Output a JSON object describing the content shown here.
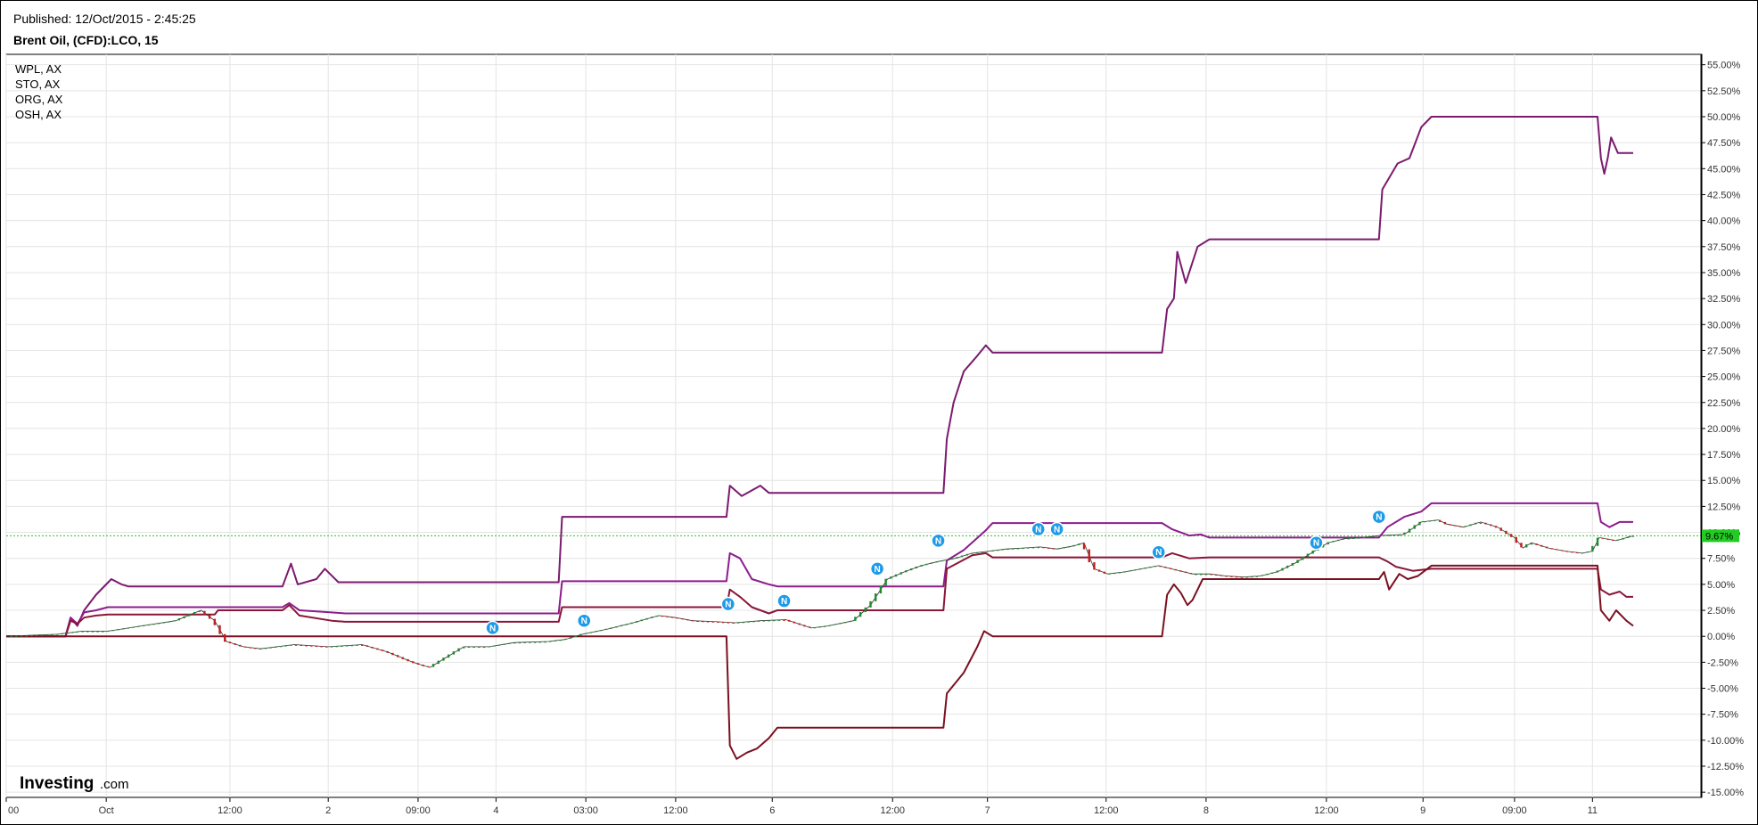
{
  "header": {
    "published": "Published: 12/Oct/2015 - 2:45:25",
    "title": "Brent Oil, (CFD):LCO, 15"
  },
  "logo": {
    "text": "Investing",
    "suffix": ".com"
  },
  "colors": {
    "wpl": "#7b1a6e",
    "sto": "#8c1c8c",
    "org": "#8a1638",
    "osh": "#7a1020",
    "up_candle": "#1e8a2e",
    "down_candle": "#c0201c",
    "price_line": "#22cc22",
    "price_label_bg": "#22cc22",
    "news_marker": "#1e9be8",
    "grid": "#e4e4e4"
  },
  "chart_data": {
    "type": "line",
    "title": "Brent Oil, (CFD):LCO, 15",
    "y_axis": {
      "position": "right",
      "range": [
        -15.5,
        56
      ],
      "ticks": [
        55,
        52.5,
        50,
        47.5,
        45,
        42.5,
        40,
        37.5,
        35,
        32.5,
        30,
        27.5,
        25,
        22.5,
        20,
        17.5,
        15,
        12.5,
        10,
        7.5,
        5,
        2.5,
        0,
        -2.5,
        -5,
        -7.5,
        -10,
        -12.5,
        -15
      ],
      "tick_labels": [
        "55.00%",
        "52.50%",
        "50.00%",
        "47.50%",
        "45.00%",
        "42.50%",
        "40.00%",
        "37.50%",
        "35.00%",
        "32.50%",
        "30.00%",
        "27.50%",
        "25.00%",
        "22.50%",
        "20.00%",
        "17.50%",
        "15.00%",
        "12.50%",
        "10.00%",
        "7.50%",
        "5.00%",
        "2.50%",
        "0.00%",
        "-2.50%",
        "-5.00%",
        "-7.50%",
        "-10.00%",
        "-12.50%",
        "-15.00%"
      ]
    },
    "x_axis": {
      "range": [
        0,
        100
      ],
      "tick_positions": [
        0,
        5.9,
        13.2,
        19.0,
        24.3,
        28.9,
        34.2,
        39.5,
        45.2,
        52.3,
        57.9,
        64.9,
        70.8,
        77.9,
        83.6,
        89.0,
        93.6
      ],
      "tick_labels": [
        "00",
        "Oct",
        "12:00",
        "2",
        "09:00",
        "4",
        "03:00",
        "12:00",
        "6",
        "12:00",
        "7",
        "12:00",
        "8",
        "12:00",
        "9",
        "09:00",
        "11"
      ]
    },
    "legend": [
      "WPL, AX",
      "STO, AX",
      "ORG, AX",
      "OSH, AX"
    ],
    "legend_placement": "top-left",
    "grid": true,
    "current_value": 9.67,
    "current_value_label": "9.67%",
    "series": [
      {
        "name": "WPL, AX",
        "points": [
          [
            0,
            0
          ],
          [
            3.5,
            0
          ],
          [
            3.8,
            1.8
          ],
          [
            4.2,
            1
          ],
          [
            4.6,
            2.5
          ],
          [
            5.3,
            4
          ],
          [
            6.2,
            5.5
          ],
          [
            6.8,
            5
          ],
          [
            7.2,
            4.8
          ],
          [
            16.3,
            4.8
          ],
          [
            16.8,
            7
          ],
          [
            17.2,
            5
          ],
          [
            18.3,
            5.5
          ],
          [
            18.8,
            6.5
          ],
          [
            19.6,
            5.2
          ],
          [
            32.6,
            5.2
          ],
          [
            32.8,
            11.5
          ],
          [
            42.5,
            11.5
          ],
          [
            42.7,
            14.5
          ],
          [
            43.4,
            13.5
          ],
          [
            44.5,
            14.5
          ],
          [
            45,
            13.8
          ],
          [
            55.3,
            13.8
          ],
          [
            55.5,
            19
          ],
          [
            55.9,
            22.5
          ],
          [
            56.5,
            25.5
          ],
          [
            57.3,
            27
          ],
          [
            57.8,
            28
          ],
          [
            58.2,
            27.3
          ],
          [
            68.2,
            27.3
          ],
          [
            68.5,
            31.5
          ],
          [
            68.9,
            32.5
          ],
          [
            69.1,
            37
          ],
          [
            69.6,
            34
          ],
          [
            70.3,
            37.5
          ],
          [
            71,
            38.2
          ],
          [
            81,
            38.2
          ],
          [
            81.2,
            43
          ],
          [
            82.1,
            45.5
          ],
          [
            82.8,
            46
          ],
          [
            83.5,
            49
          ],
          [
            84.1,
            50
          ],
          [
            93.9,
            50
          ],
          [
            94.1,
            46
          ],
          [
            94.3,
            44.5
          ],
          [
            94.5,
            46
          ],
          [
            94.7,
            48
          ],
          [
            95.1,
            46.5
          ],
          [
            96,
            46.5
          ]
        ]
      },
      {
        "name": "STO, AX",
        "points": [
          [
            0,
            0
          ],
          [
            3.5,
            0
          ],
          [
            3.8,
            1.8
          ],
          [
            4.2,
            1.2
          ],
          [
            4.6,
            2.3
          ],
          [
            5.3,
            2.5
          ],
          [
            6,
            2.8
          ],
          [
            16.3,
            2.8
          ],
          [
            16.7,
            3.2
          ],
          [
            17.3,
            2.5
          ],
          [
            19.2,
            2.3
          ],
          [
            20,
            2.2
          ],
          [
            32.6,
            2.2
          ],
          [
            32.8,
            5.3
          ],
          [
            42.5,
            5.3
          ],
          [
            42.7,
            8
          ],
          [
            43.3,
            7.5
          ],
          [
            44,
            5.5
          ],
          [
            45,
            5
          ],
          [
            45.5,
            4.8
          ],
          [
            55.3,
            4.8
          ],
          [
            55.5,
            7.3
          ],
          [
            56.5,
            8.3
          ],
          [
            57.8,
            10.2
          ],
          [
            58.2,
            10.9
          ],
          [
            68.2,
            10.9
          ],
          [
            68.8,
            10.3
          ],
          [
            69.8,
            9.7
          ],
          [
            70.5,
            9.8
          ],
          [
            71,
            9.5
          ],
          [
            81,
            9.5
          ],
          [
            81.5,
            10.5
          ],
          [
            82.5,
            11.5
          ],
          [
            83.5,
            12
          ],
          [
            84.1,
            12.8
          ],
          [
            93.9,
            12.8
          ],
          [
            94.1,
            11
          ],
          [
            94.6,
            10.5
          ],
          [
            95.2,
            11
          ],
          [
            96,
            11
          ]
        ]
      },
      {
        "name": "ORG, AX",
        "points": [
          [
            0,
            0
          ],
          [
            3.5,
            0
          ],
          [
            3.8,
            1.5
          ],
          [
            4.2,
            1.2
          ],
          [
            4.6,
            1.8
          ],
          [
            5.3,
            2
          ],
          [
            6,
            2.1
          ],
          [
            12.3,
            2.1
          ],
          [
            12.5,
            2.5
          ],
          [
            16.3,
            2.5
          ],
          [
            16.7,
            3
          ],
          [
            17.3,
            2
          ],
          [
            19.2,
            1.5
          ],
          [
            20,
            1.4
          ],
          [
            32.6,
            1.4
          ],
          [
            32.8,
            2.8
          ],
          [
            39.5,
            2.8
          ],
          [
            42.5,
            2.8
          ],
          [
            42.7,
            4.5
          ],
          [
            43.3,
            3.8
          ],
          [
            44,
            2.8
          ],
          [
            45,
            2.2
          ],
          [
            45.5,
            2.5
          ],
          [
            55.3,
            2.5
          ],
          [
            55.5,
            6.5
          ],
          [
            57,
            7.8
          ],
          [
            57.8,
            8
          ],
          [
            58.2,
            7.6
          ],
          [
            68.2,
            7.6
          ],
          [
            68.8,
            8
          ],
          [
            69.8,
            7.5
          ],
          [
            71,
            7.6
          ],
          [
            81,
            7.6
          ],
          [
            81.5,
            7.2
          ],
          [
            82,
            6.7
          ],
          [
            83,
            6.3
          ],
          [
            84.1,
            6.5
          ],
          [
            93.9,
            6.5
          ],
          [
            94.1,
            4.5
          ],
          [
            94.6,
            4
          ],
          [
            95.2,
            4.3
          ],
          [
            95.6,
            3.8
          ],
          [
            96,
            3.8
          ]
        ]
      },
      {
        "name": "OSH, AX",
        "points": [
          [
            0,
            0
          ],
          [
            42.5,
            0
          ],
          [
            42.7,
            -10.5
          ],
          [
            43.1,
            -11.8
          ],
          [
            43.7,
            -11.2
          ],
          [
            44.3,
            -10.8
          ],
          [
            45,
            -9.8
          ],
          [
            45.5,
            -8.8
          ],
          [
            55.3,
            -8.8
          ],
          [
            55.5,
            -5.5
          ],
          [
            56.5,
            -3.5
          ],
          [
            57.3,
            -1
          ],
          [
            57.7,
            0.5
          ],
          [
            58.2,
            0
          ],
          [
            68.2,
            0
          ],
          [
            68.5,
            4
          ],
          [
            68.9,
            5
          ],
          [
            69.3,
            4.2
          ],
          [
            69.7,
            3
          ],
          [
            70,
            3.5
          ],
          [
            70.6,
            5.5
          ],
          [
            71.2,
            5.5
          ],
          [
            81,
            5.5
          ],
          [
            81.3,
            6.2
          ],
          [
            81.6,
            4.5
          ],
          [
            82.2,
            6
          ],
          [
            82.7,
            5.5
          ],
          [
            83.3,
            5.8
          ],
          [
            84.1,
            6.8
          ],
          [
            93.9,
            6.8
          ],
          [
            94.1,
            2.5
          ],
          [
            94.6,
            1.5
          ],
          [
            95,
            2.5
          ],
          [
            95.6,
            1.5
          ],
          [
            96,
            1
          ]
        ]
      },
      {
        "name": "Brent Oil, (CFD):LCO, 15",
        "points": [
          [
            0,
            0
          ],
          [
            3,
            0.2
          ],
          [
            4.5,
            0.5
          ],
          [
            6,
            0.5
          ],
          [
            8,
            1
          ],
          [
            10,
            1.5
          ],
          [
            11.5,
            2.5
          ],
          [
            12.3,
            1.5
          ],
          [
            13,
            -0.5
          ],
          [
            14,
            -1
          ],
          [
            15,
            -1.2
          ],
          [
            17,
            -0.8
          ],
          [
            19,
            -1
          ],
          [
            21,
            -0.8
          ],
          [
            22.5,
            -1.5
          ],
          [
            24,
            -2.5
          ],
          [
            25,
            -3
          ],
          [
            26,
            -2
          ],
          [
            27,
            -1
          ],
          [
            28.5,
            -1
          ],
          [
            30,
            -0.6
          ],
          [
            32,
            -0.5
          ],
          [
            33,
            -0.3
          ],
          [
            34,
            0.2
          ],
          [
            35.5,
            0.7
          ],
          [
            37,
            1.3
          ],
          [
            38.5,
            2
          ],
          [
            39.5,
            1.8
          ],
          [
            40.5,
            1.5
          ],
          [
            42,
            1.4
          ],
          [
            43,
            1.3
          ],
          [
            44.5,
            1.5
          ],
          [
            46,
            1.6
          ],
          [
            47.5,
            0.8
          ],
          [
            48.5,
            1
          ],
          [
            50,
            1.5
          ],
          [
            51,
            3
          ],
          [
            52,
            5.5
          ],
          [
            53,
            6.2
          ],
          [
            54,
            6.8
          ],
          [
            55,
            7.2
          ],
          [
            56,
            7.5
          ],
          [
            57,
            8
          ],
          [
            58,
            8.2
          ],
          [
            59,
            8.4
          ],
          [
            60,
            8.5
          ],
          [
            61,
            8.6
          ],
          [
            62,
            8.4
          ],
          [
            63,
            8.7
          ],
          [
            63.6,
            9
          ],
          [
            64.2,
            6.5
          ],
          [
            65,
            6
          ],
          [
            66,
            6.2
          ],
          [
            67,
            6.5
          ],
          [
            68,
            6.8
          ],
          [
            69,
            6.4
          ],
          [
            70,
            6
          ],
          [
            71,
            6
          ],
          [
            72,
            5.8
          ],
          [
            73,
            5.7
          ],
          [
            74,
            5.8
          ],
          [
            75,
            6.2
          ],
          [
            76,
            7
          ],
          [
            77,
            8
          ],
          [
            78,
            9
          ],
          [
            79,
            9.4
          ],
          [
            80,
            9.5
          ],
          [
            81,
            9.7
          ],
          [
            82.5,
            9.8
          ],
          [
            83.5,
            11
          ],
          [
            84.5,
            11.2
          ],
          [
            85,
            10.8
          ],
          [
            86,
            10.5
          ],
          [
            87,
            11
          ],
          [
            88,
            10.5
          ],
          [
            89,
            9.5
          ],
          [
            89.5,
            8.5
          ],
          [
            90,
            9
          ],
          [
            91,
            8.5
          ],
          [
            92,
            8.2
          ],
          [
            93,
            8
          ],
          [
            93.6,
            8.2
          ],
          [
            94,
            9.5
          ],
          [
            95,
            9.2
          ],
          [
            96,
            9.67
          ]
        ]
      }
    ],
    "news_markers": [
      {
        "x": 28.7,
        "y": 0.8
      },
      {
        "x": 34.1,
        "y": 1.5
      },
      {
        "x": 42.6,
        "y": 3.1
      },
      {
        "x": 45.9,
        "y": 3.4
      },
      {
        "x": 51.4,
        "y": 6.5
      },
      {
        "x": 55.0,
        "y": 9.2
      },
      {
        "x": 60.9,
        "y": 10.3
      },
      {
        "x": 62.0,
        "y": 10.3
      },
      {
        "x": 68.0,
        "y": 8.1
      },
      {
        "x": 77.3,
        "y": 9.0
      },
      {
        "x": 81.0,
        "y": 11.5
      }
    ]
  }
}
